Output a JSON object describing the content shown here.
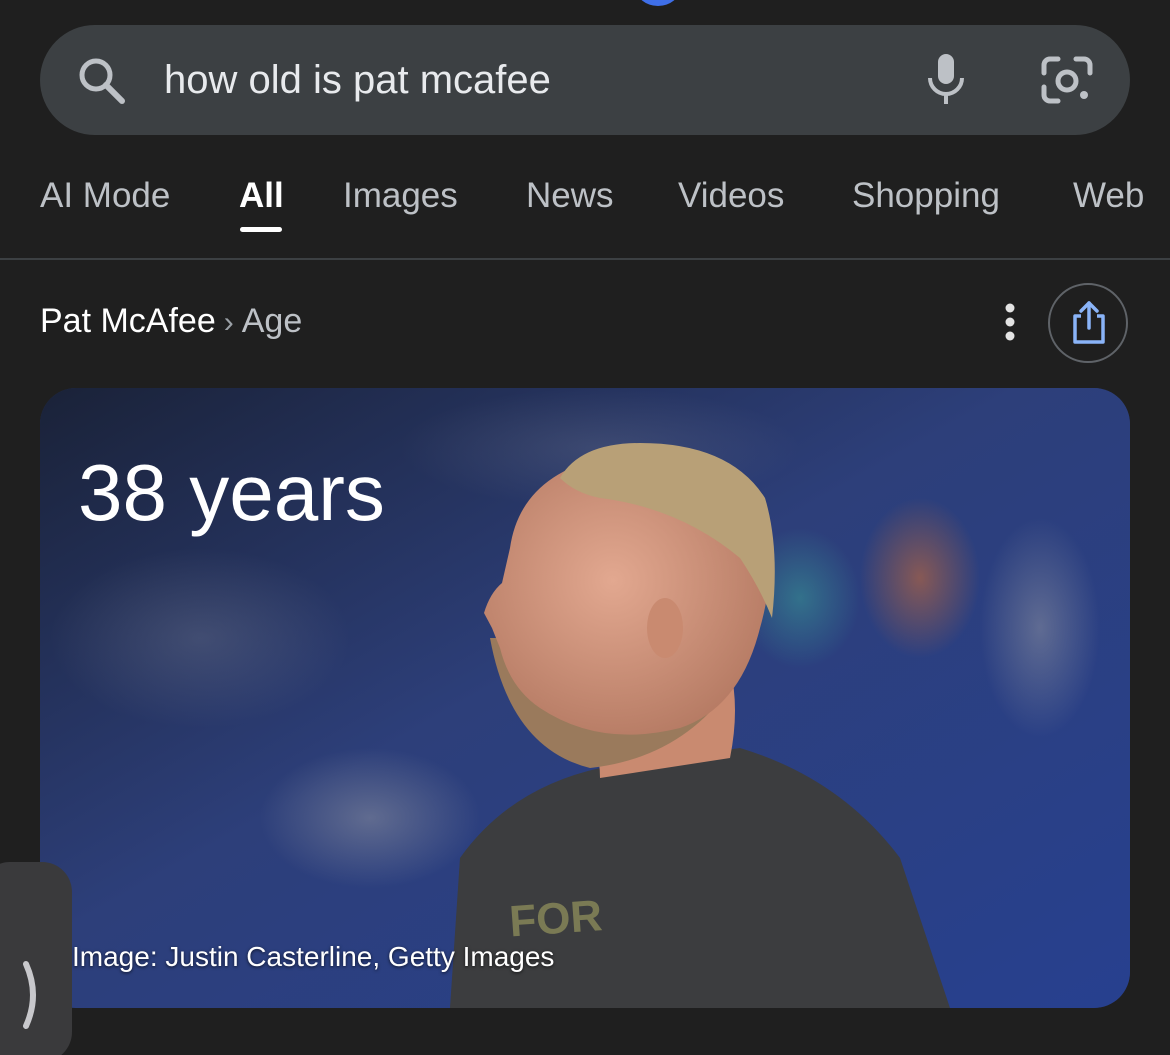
{
  "search": {
    "query": "how old is pat mcafee"
  },
  "tabs": [
    {
      "label": "AI Mode",
      "active": false
    },
    {
      "label": "All",
      "active": true
    },
    {
      "label": "Images",
      "active": false
    },
    {
      "label": "News",
      "active": false
    },
    {
      "label": "Videos",
      "active": false
    },
    {
      "label": "Shopping",
      "active": false
    },
    {
      "label": "Web",
      "active": false
    }
  ],
  "breadcrumb": {
    "entity": "Pat McAfee",
    "separator": "›",
    "attribute": "Age"
  },
  "answer_card": {
    "value": "38 years",
    "image_credit": "Image: Justin Casterline, Getty Images"
  },
  "icons": {
    "search": "search-icon",
    "mic": "mic-icon",
    "lens": "lens-icon",
    "more": "more-vert-icon",
    "share": "share-icon",
    "expand": "chevron-right-icon"
  },
  "colors": {
    "background": "#1f1f1f",
    "search_bar": "#3c4043",
    "accent": "#3f6fe8",
    "share_icon": "#8ab4f8"
  }
}
